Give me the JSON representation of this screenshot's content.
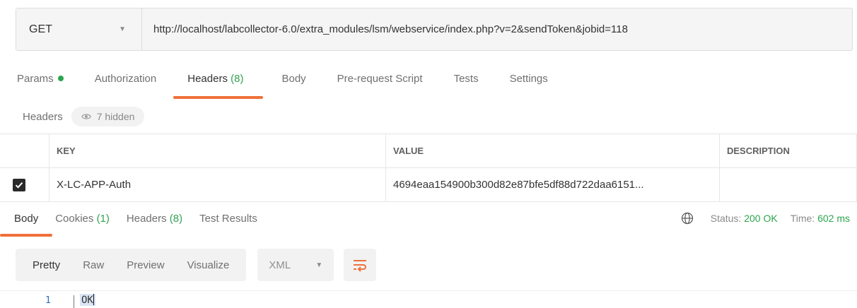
{
  "request": {
    "method": "GET",
    "url": "http://localhost/labcollector-6.0/extra_modules/lsm/webservice/index.php?v=2&sendToken&jobid=118"
  },
  "request_tabs": [
    {
      "label": "Params",
      "has_dot": true
    },
    {
      "label": "Authorization"
    },
    {
      "label": "Headers ",
      "count": "(8)",
      "active": true
    },
    {
      "label": "Body"
    },
    {
      "label": "Pre-request Script"
    },
    {
      "label": "Tests"
    },
    {
      "label": "Settings"
    }
  ],
  "headers_section": {
    "label": "Headers",
    "hidden_text": "7 hidden"
  },
  "headers_table": {
    "columns": [
      "KEY",
      "VALUE",
      "DESCRIPTION"
    ],
    "rows": [
      {
        "checked": true,
        "key": "X-LC-APP-Auth",
        "value": "4694eaa154900b300d82e87bfe5df88d722daa6151...",
        "description": ""
      }
    ]
  },
  "response_tabs": [
    {
      "label": "Body",
      "active": true
    },
    {
      "label": "Cookies ",
      "count": "(1)"
    },
    {
      "label": "Headers ",
      "count": "(8)"
    },
    {
      "label": "Test Results"
    }
  ],
  "status": {
    "status_label": "Status:",
    "status_value": "200 OK",
    "time_label": "Time:",
    "time_value": "602 ms"
  },
  "response_toolbar": {
    "views": [
      "Pretty",
      "Raw",
      "Preview",
      "Visualize"
    ],
    "active_view": "Pretty",
    "format": "XML"
  },
  "response_body": {
    "line_number": "1",
    "text": "OK"
  },
  "colors": {
    "accent": "#f0703a",
    "success": "#2ba54d"
  },
  "icons": {
    "method_dropdown": "chevron-down-icon",
    "hidden": "eye-icon",
    "network": "globe-icon",
    "wrap": "wrap-lines-icon"
  }
}
